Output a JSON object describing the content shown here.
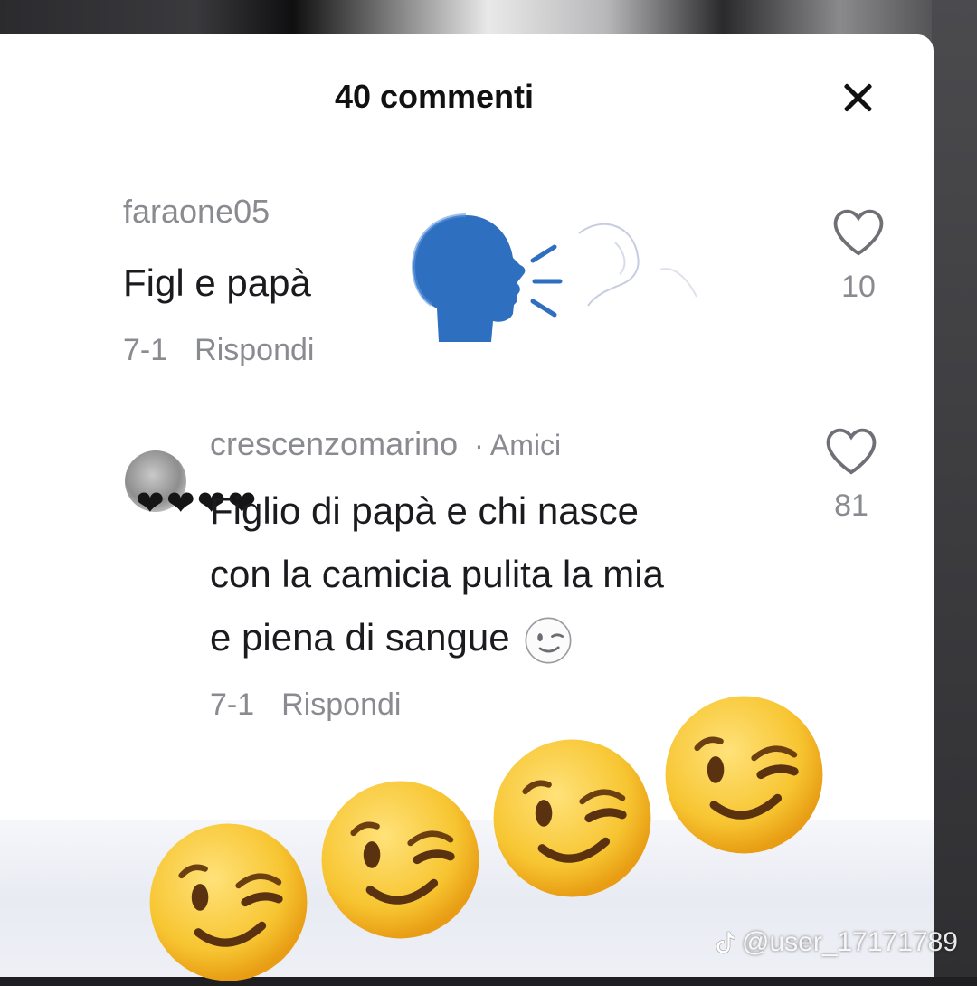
{
  "header": {
    "title": "40 commenti"
  },
  "comments": [
    {
      "username": "faraone05",
      "text": "Figl e papà",
      "date": "7-1",
      "reply_label": "Rispondi",
      "likes": "10"
    },
    {
      "username": "crescenzomarino",
      "friend_badge": "· Amici",
      "text_lines": [
        "Figlio di papà e chi nasce",
        "con la camicia pulita la mia",
        "e piena di sangue"
      ],
      "date": "7-1",
      "reply_label": "Rispondi",
      "likes": "81"
    }
  ],
  "watermark": {
    "handle": "@user_17171789"
  },
  "colors": {
    "secondary_text": "#8a8b91",
    "primary_text": "#1b1b1f",
    "emoji_yellow": "#f7c531"
  }
}
